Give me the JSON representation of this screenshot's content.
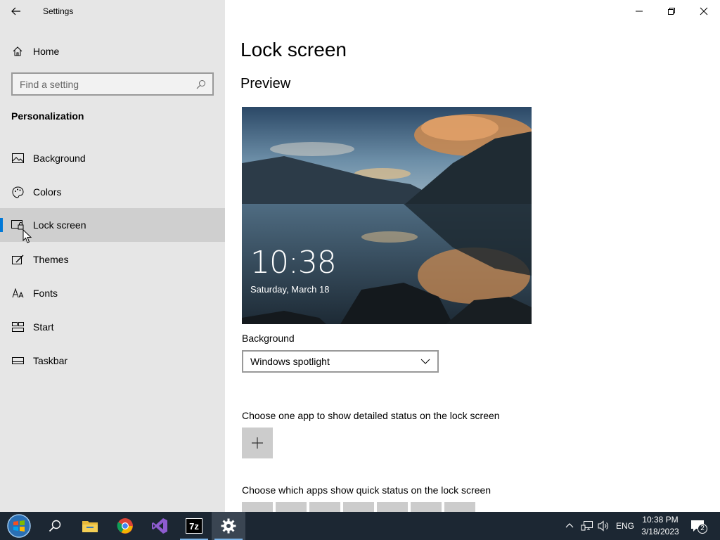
{
  "window": {
    "title": "Settings"
  },
  "sidebar": {
    "home_label": "Home",
    "search_placeholder": "Find a setting",
    "section_title": "Personalization",
    "items": [
      {
        "label": "Background",
        "icon": "picture-icon"
      },
      {
        "label": "Colors",
        "icon": "palette-icon"
      },
      {
        "label": "Lock screen",
        "icon": "lock-screen-icon",
        "selected": true
      },
      {
        "label": "Themes",
        "icon": "brush-icon"
      },
      {
        "label": "Fonts",
        "icon": "font-icon"
      },
      {
        "label": "Start",
        "icon": "start-icon"
      },
      {
        "label": "Taskbar",
        "icon": "taskbar-icon"
      }
    ]
  },
  "main": {
    "title": "Lock screen",
    "preview_title": "Preview",
    "preview_time": "10:38",
    "preview_date": "Saturday, March 18",
    "background_label": "Background",
    "background_value": "Windows spotlight",
    "detailed_status_label": "Choose one app to show detailed status on the lock screen",
    "quick_status_label": "Choose which apps show quick status on the lock screen"
  },
  "taskbar": {
    "apps": [
      "start-orb-icon",
      "search-icon",
      "file-explorer-icon",
      "chrome-icon",
      "visual-studio-icon",
      "7zip-icon",
      "settings-icon"
    ],
    "sevenzip_label": "7z",
    "language": "ENG",
    "time": "10:38 PM",
    "date": "3/18/2023",
    "notification_count": "2"
  },
  "colors": {
    "accent": "#0078d7",
    "sidebar_bg": "#e6e6e6",
    "selected_bg": "#cfcfcf",
    "taskbar_bg": "#1c2733"
  }
}
